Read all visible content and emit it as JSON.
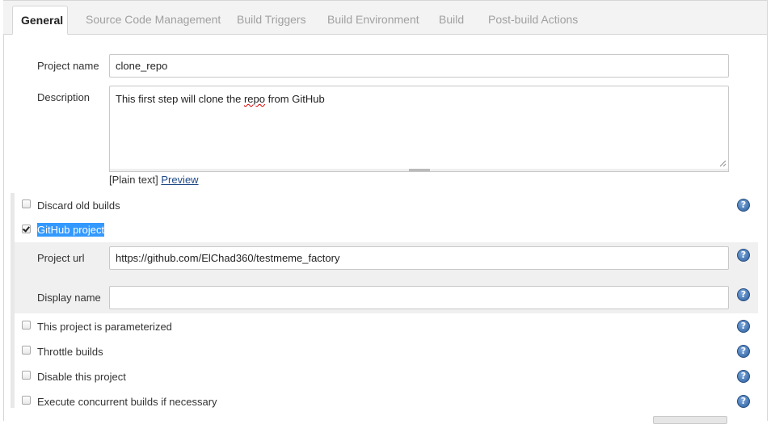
{
  "tabs": [
    {
      "label": "General",
      "active": true
    },
    {
      "label": "Source Code Management",
      "active": false
    },
    {
      "label": "Build Triggers",
      "active": false
    },
    {
      "label": "Build Environment",
      "active": false
    },
    {
      "label": "Build",
      "active": false
    },
    {
      "label": "Post-build Actions",
      "active": false
    }
  ],
  "project_name": {
    "label": "Project name",
    "value": "clone_repo"
  },
  "description": {
    "label": "Description",
    "value_before": "This first step will clone the ",
    "value_misspelled": "repo",
    "value_after": " from GitHub",
    "format_text": "[Plain text]",
    "preview_link": "Preview"
  },
  "options": {
    "discard_old_builds": {
      "label": "Discard old builds",
      "checked": false
    },
    "github_project": {
      "label": "GitHub project",
      "checked": true
    },
    "parameterized": {
      "label": "This project is parameterized",
      "checked": false
    },
    "throttle_builds": {
      "label": "Throttle builds",
      "checked": false
    },
    "disable_project": {
      "label": "Disable this project",
      "checked": false
    },
    "concurrent_builds": {
      "label": "Execute concurrent builds if necessary",
      "checked": false
    }
  },
  "github": {
    "project_url_label": "Project url",
    "project_url_value": "https://github.com/ElChad360/testmeme_factory",
    "display_name_label": "Display name",
    "display_name_value": ""
  },
  "help_icon_glyph": "?",
  "colors": {
    "accent_selection": "#3399ff",
    "link": "#204a87"
  }
}
